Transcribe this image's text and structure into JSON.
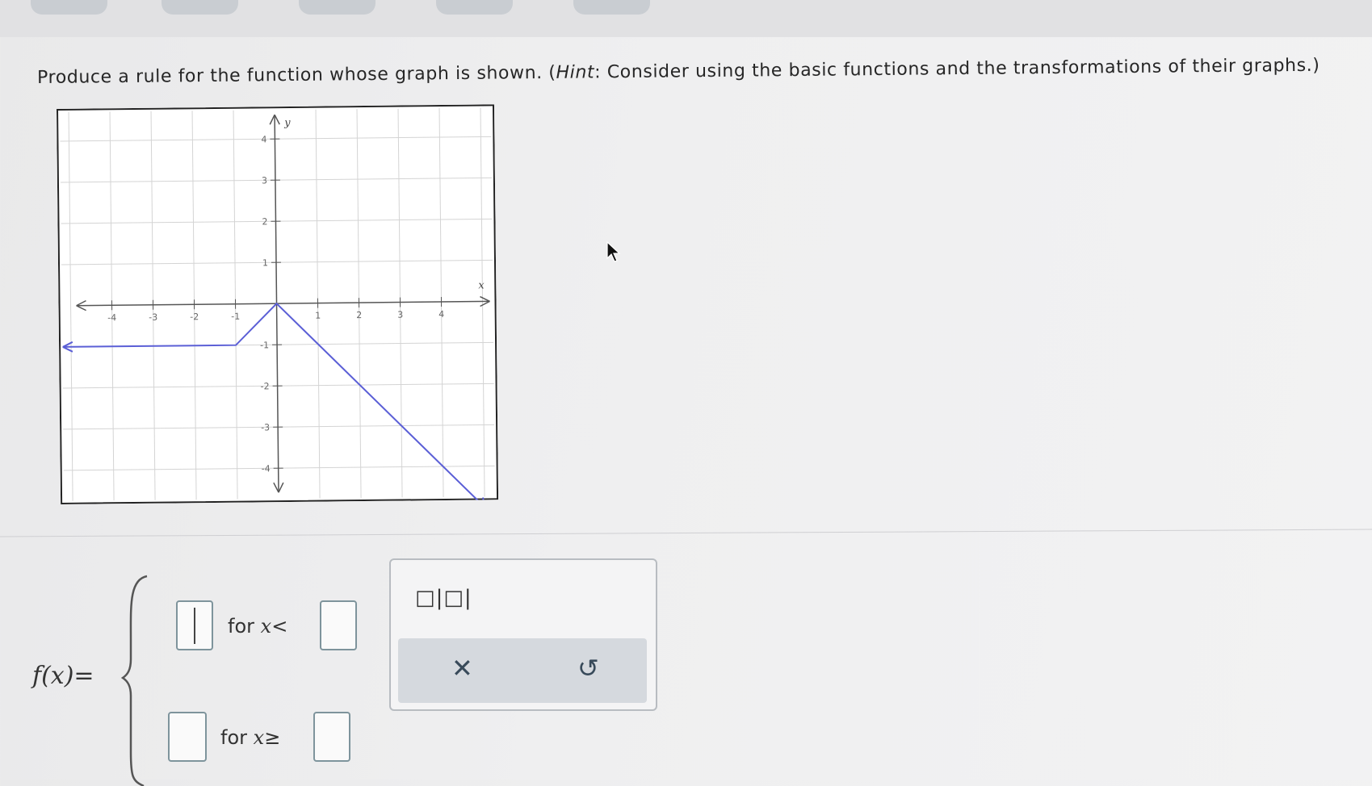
{
  "question": {
    "prefix": "Produce a rule for the function whose graph is shown. (",
    "hint_word": "Hint",
    "suffix": ": Consider using the basic functions and the transformations of their graphs.)"
  },
  "graph": {
    "x_label": "x",
    "y_label": "y",
    "x_ticks": [
      "-4",
      "-3",
      "-2",
      "-1",
      "1",
      "2",
      "3",
      "4"
    ],
    "y_ticks": [
      "4",
      "3",
      "2",
      "1",
      "-1",
      "-2",
      "-3",
      "-4"
    ],
    "line_color": "#5b5fd6",
    "function_points": [
      [
        -5.2,
        -1
      ],
      [
        -1,
        -1
      ],
      [
        0,
        0
      ],
      [
        5,
        -5
      ]
    ]
  },
  "answer": {
    "lhs": "f(x)=",
    "row1_label": "for",
    "row1_var": "x",
    "row1_op": "<",
    "row2_label": "for",
    "row2_var": "x",
    "row2_op": "≥"
  },
  "palette": {
    "template_symbol": "□|□|",
    "clear_symbol": "✕",
    "undo_symbol": "↺"
  }
}
